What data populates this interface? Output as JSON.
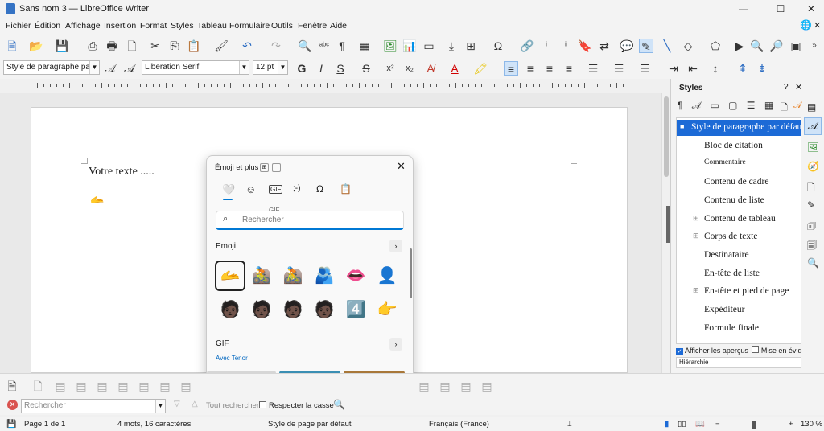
{
  "window": {
    "title": "Sans nom 3 — LibreOffice Writer"
  },
  "menu": [
    "Fichier",
    "Édition",
    "Affichage",
    "Insertion",
    "Format",
    "Styles",
    "Tableau",
    "Formulaire",
    "Outils",
    "Fenêtre",
    "Aide"
  ],
  "format_bar": {
    "paragraph_style": "Style de paragraphe par défaut",
    "font_name": "Liberation Serif",
    "font_size": "12 pt"
  },
  "document": {
    "text": "Votre texte ....."
  },
  "emoji_panel": {
    "title": "Émoji et plus",
    "search_placeholder": "Rechercher",
    "tooltip": "GIF",
    "emoji_heading": "Emoji",
    "gif_heading": "GIF",
    "gif_sub": "Avec Tenor",
    "emojis_row1": [
      "🫴",
      "🚵",
      "🚵",
      "🫂",
      "👄",
      "👤"
    ],
    "emojis_row2": [
      "🧑🏿",
      "🧑🏿",
      "🧑🏿",
      "🧑🏿",
      "4️⃣",
      "👉"
    ],
    "tabs": [
      "emoji-tab",
      "smiley-tab",
      "gif-tab",
      "kaomoji-tab",
      "symbols-tab",
      "clipboard-tab"
    ]
  },
  "sidebar": {
    "title": "Styles",
    "styles": [
      "Style de paragraphe par défaut",
      "Bloc de citation",
      "Commentaire",
      "Contenu de cadre",
      "Contenu de liste",
      "Contenu de tableau",
      "Corps de texte",
      "Destinataire",
      "En-tête de liste",
      "En-tête et pied de page",
      "Expéditeur",
      "Formule finale"
    ],
    "show_previews": "Afficher les aperçus",
    "highlight": "Mise en évider",
    "hierarchy": "Hiérarchie"
  },
  "findbar": {
    "placeholder": "Rechercher",
    "find_all": "Tout rechercher",
    "match_case": "Respecter la casse"
  },
  "status": {
    "page": "Page 1 de 1",
    "words": "4 mots, 16 caractères",
    "page_style": "Style de page par défaut",
    "language": "Français (France)",
    "zoom": "130 %"
  },
  "colors": {
    "accent": "#0078d4",
    "selected": "#1c6ad6"
  }
}
